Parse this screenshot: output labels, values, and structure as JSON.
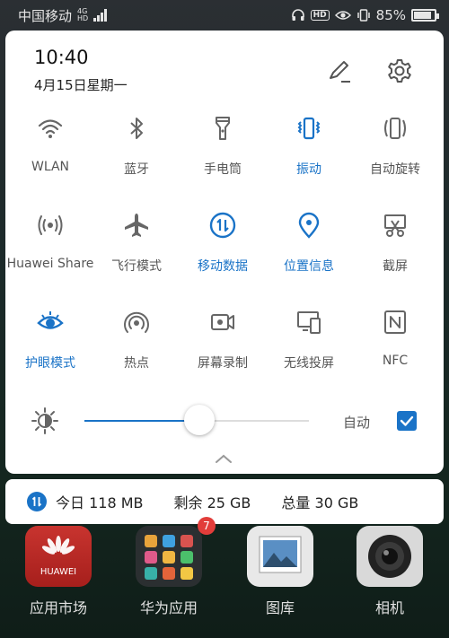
{
  "status_bar": {
    "carrier": "中国移动",
    "network_top": "4G",
    "network_bottom": "HD",
    "hd_badge": "HD",
    "battery": "85%",
    "battery_level": 0.85,
    "icons": [
      "headphones-icon",
      "hd-icon",
      "eye-icon",
      "vibrate-icon",
      "battery-icon"
    ]
  },
  "header": {
    "time": "10:40",
    "date": "4月15日星期一",
    "icons": [
      "edit-icon",
      "gear-icon"
    ]
  },
  "accent_color": "#1a73c7",
  "tiles": [
    {
      "label": "WLAN",
      "icon": "wifi-icon",
      "active": false
    },
    {
      "label": "蓝牙",
      "icon": "bluetooth-icon",
      "active": false
    },
    {
      "label": "手电筒",
      "icon": "flashlight-icon",
      "active": false
    },
    {
      "label": "振动",
      "icon": "vibrate-icon",
      "active": true
    },
    {
      "label": "自动旋转",
      "icon": "rotate-icon",
      "active": false
    },
    {
      "label": "Huawei Share",
      "icon": "share-icon",
      "active": false
    },
    {
      "label": "飞行模式",
      "icon": "airplane-icon",
      "active": false
    },
    {
      "label": "移动数据",
      "icon": "mobile-data-icon",
      "active": true
    },
    {
      "label": "位置信息",
      "icon": "location-icon",
      "active": true
    },
    {
      "label": "截屏",
      "icon": "screenshot-icon",
      "active": false
    },
    {
      "label": "护眼模式",
      "icon": "eye-comfort-icon",
      "active": true
    },
    {
      "label": "热点",
      "icon": "hotspot-icon",
      "active": false
    },
    {
      "label": "屏幕录制",
      "icon": "screen-record-icon",
      "active": false
    },
    {
      "label": "无线投屏",
      "icon": "wireless-projection-icon",
      "active": false
    },
    {
      "label": "NFC",
      "icon": "nfc-icon",
      "active": false
    }
  ],
  "brightness": {
    "level": 0.51,
    "auto_label": "自动",
    "auto_checked": true
  },
  "data_usage": {
    "today": "今日 118 MB",
    "remaining": "剩余 25 GB",
    "total": "总量 30 GB"
  },
  "apps": [
    {
      "label": "应用市场",
      "icon_text": "HUAWEI"
    },
    {
      "label": "华为应用",
      "badge": "7"
    },
    {
      "label": "图库"
    },
    {
      "label": "相机"
    }
  ]
}
